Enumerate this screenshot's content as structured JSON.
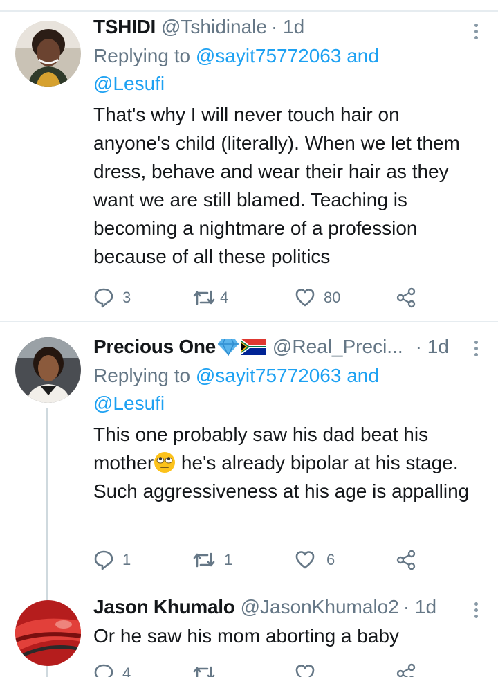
{
  "tweets": [
    {
      "name": "TSHIDI",
      "handle": "@Tshidinale",
      "time": "· 1d",
      "replying_prefix": "Replying to ",
      "replying_mention1": "@sayit75772063",
      "replying_and": " and",
      "replying_mention2": "@Lesufi",
      "text": "That's why I will never touch hair on anyone's child (literally). When we let them dress, behave and wear their hair as they want we are still blamed. Teaching is becoming a nightmare of a profession because of all these politics",
      "replies": "3",
      "retweets": "4",
      "likes": "80"
    },
    {
      "name": "Precious One",
      "handle": "@Real_Preci...",
      "time": "· 1d",
      "replying_prefix": "Replying to ",
      "replying_mention1": "@sayit75772063",
      "replying_and": " and",
      "replying_mention2": "@Lesufi",
      "text_before_emoji": "This one probably saw his dad beat his mother",
      "text_after_emoji": " he's already bipolar at his stage. Such aggressiveness at his age is appalling",
      "replies": "1",
      "retweets": "1",
      "likes": "6"
    },
    {
      "name": "Jason Khumalo",
      "handle": "@JasonKhumalo2",
      "time": "· 1d",
      "text": "Or he saw his mom aborting a baby",
      "replies": "4"
    }
  ],
  "icons": {
    "reply": "speech-bubble-icon",
    "retweet": "retweet-icon",
    "like": "heart-icon",
    "share": "share-icon",
    "more": "vertical-dots-icon"
  },
  "colors": {
    "link": "#1da1f2",
    "secondary": "#657786",
    "divider": "#e6ecf0"
  }
}
